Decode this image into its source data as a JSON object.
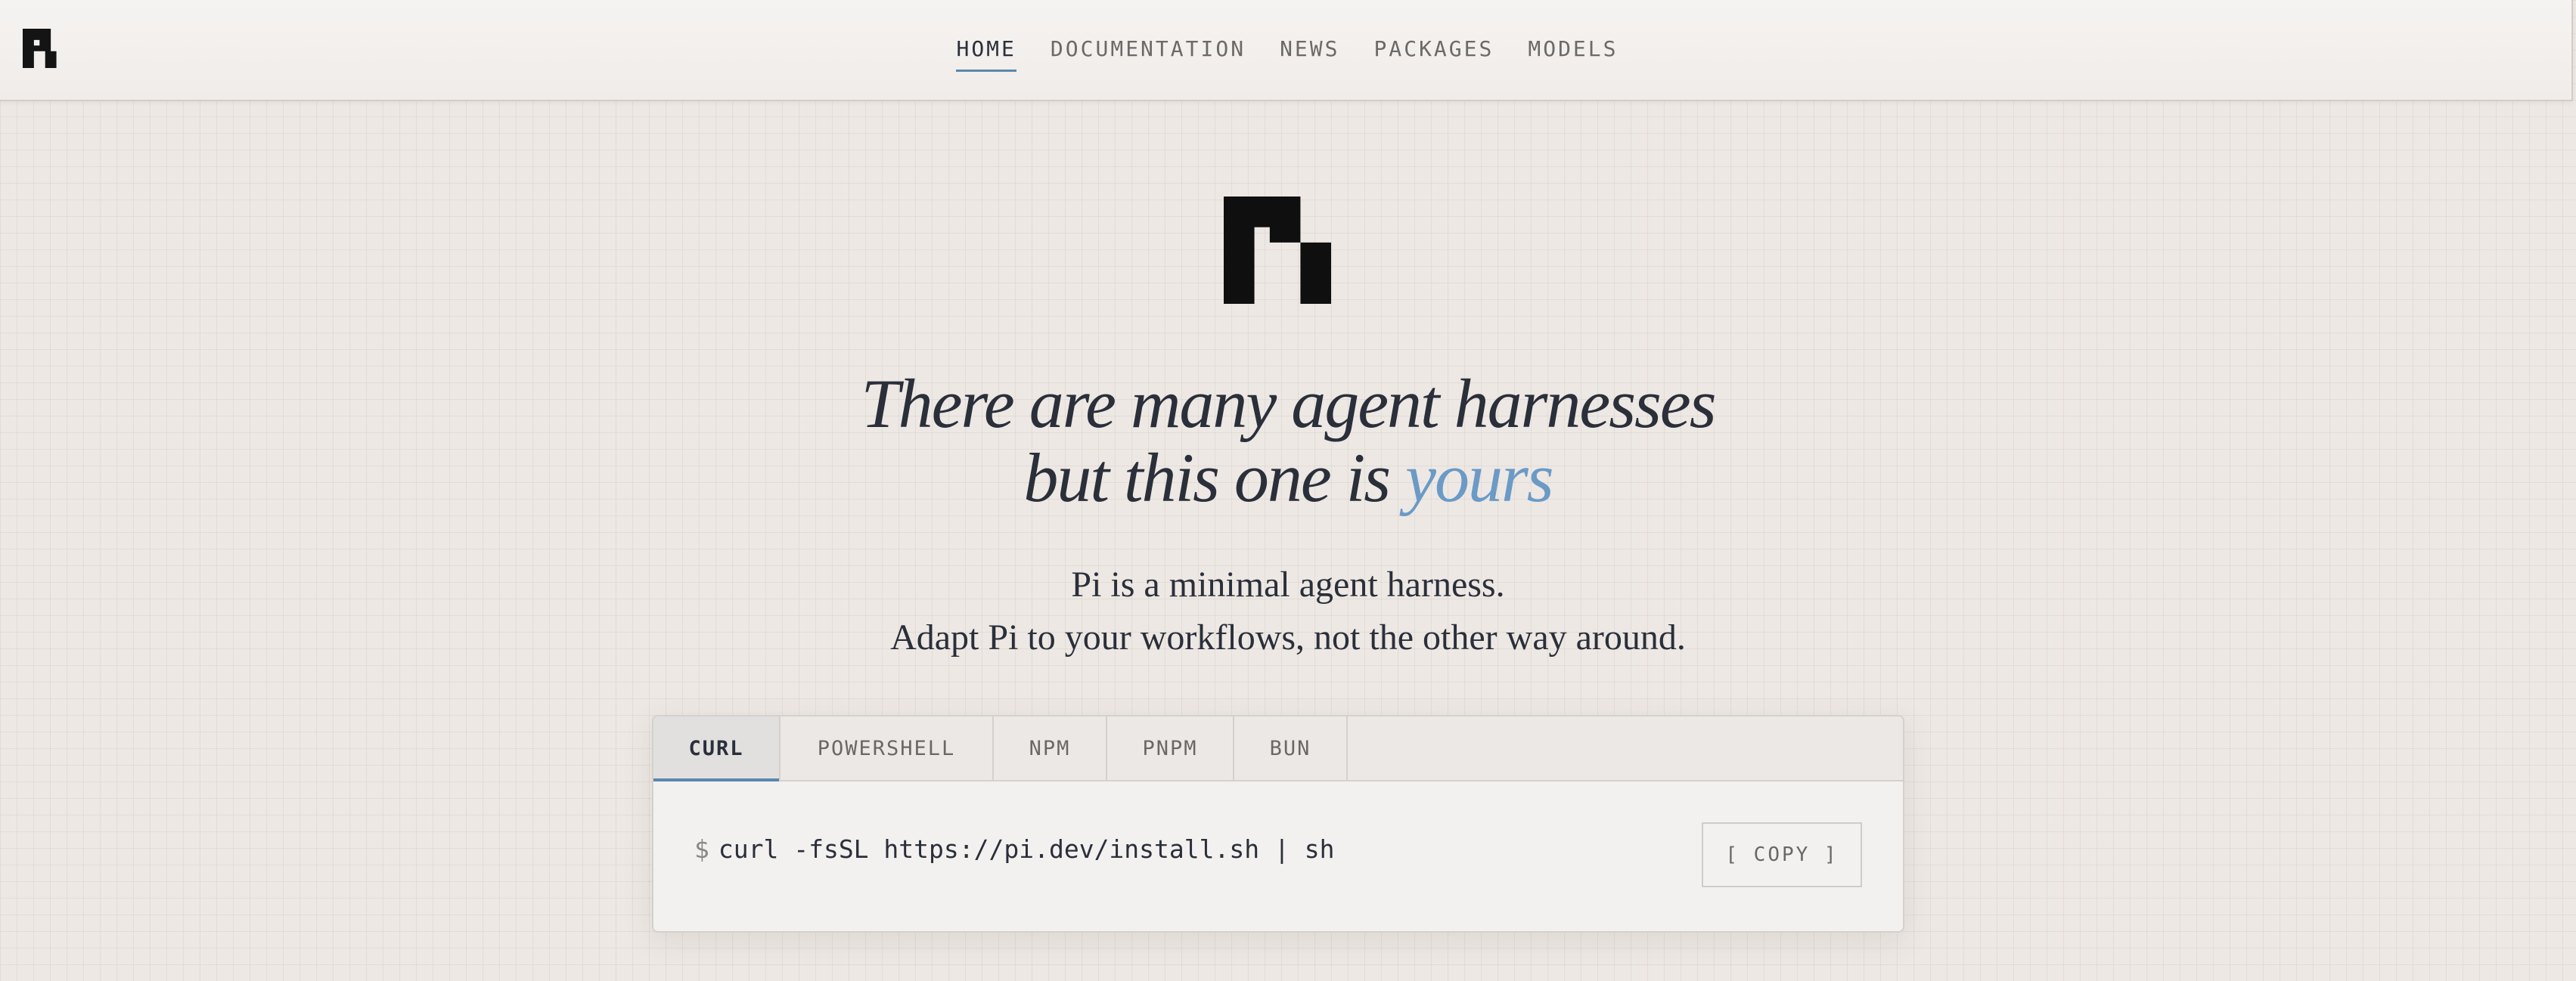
{
  "header": {
    "logo": "pi-logo",
    "nav": [
      {
        "label": "HOME",
        "active": true
      },
      {
        "label": "DOCUMENTATION",
        "active": false
      },
      {
        "label": "NEWS",
        "active": false
      },
      {
        "label": "PACKAGES",
        "active": false
      },
      {
        "label": "MODELS",
        "active": false
      }
    ]
  },
  "hero": {
    "logo": "pi-logo",
    "headline_line1": "There are many agent harnesses",
    "headline_line2": "but this one is",
    "headline_accent": "yours",
    "subline1": "Pi is a minimal agent harness.",
    "subline2": "Adapt Pi to your workflows, not the other way around."
  },
  "install": {
    "tabs": [
      {
        "label": "CURL",
        "active": true
      },
      {
        "label": "POWERSHELL",
        "active": false
      },
      {
        "label": "NPM",
        "active": false
      },
      {
        "label": "PNPM",
        "active": false
      },
      {
        "label": "BUN",
        "active": false
      }
    ],
    "prompt": "$",
    "command": "curl -fsSL https://pi.dev/install.sh | sh",
    "copy_label": "[ COPY ]"
  },
  "colors": {
    "accent": "#6b9ac6",
    "text": "#2a2f3a",
    "background": "#ede8e4"
  }
}
